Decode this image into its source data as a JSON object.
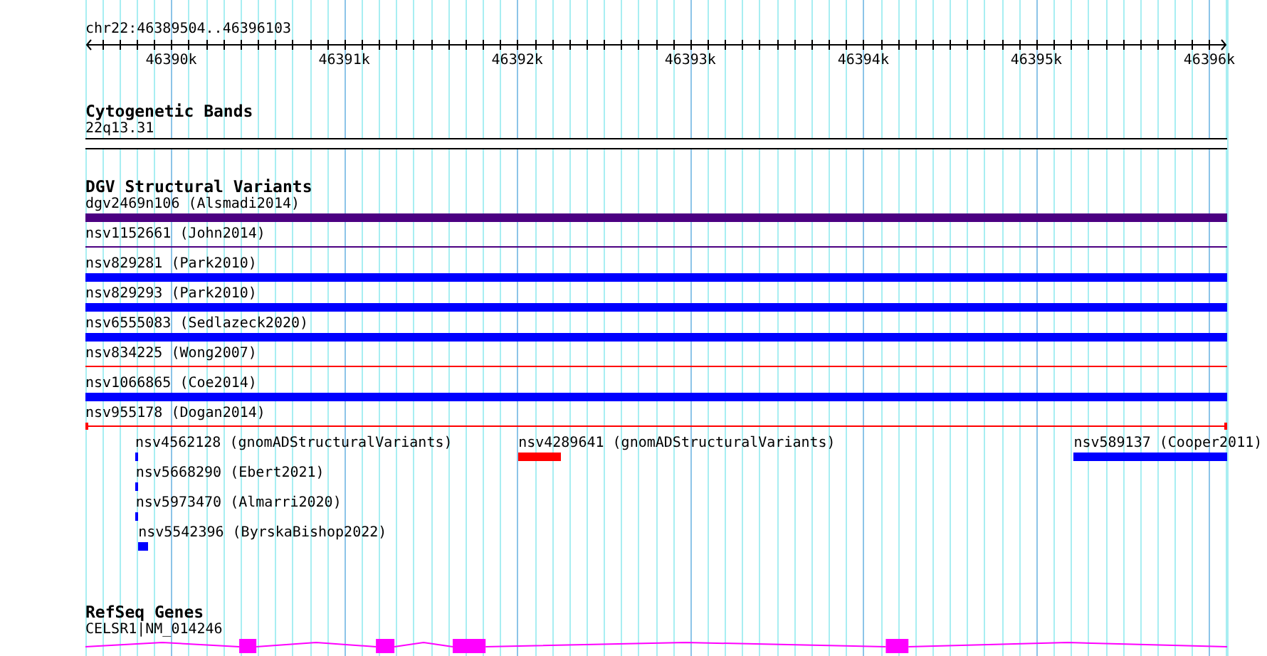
{
  "ruler": {
    "location": "chr22:46389504..46396103",
    "tick_labels": [
      "46390k",
      "46391k",
      "46392k",
      "46393k",
      "46394k",
      "46395k",
      "46396k"
    ]
  },
  "cytoband_track": {
    "title": "Cytogenetic Bands",
    "band": "22q13.31"
  },
  "variant_track": {
    "title": "DGV Structural Variants",
    "lanes": [
      [
        {
          "label": "dgv2469n106 (Alsmadi2014)",
          "kind": "bar",
          "color": "#4b0082"
        }
      ],
      [
        {
          "label": "nsv1152661 (John2014)",
          "kind": "line",
          "color": "#4b0082"
        }
      ],
      [
        {
          "label": "nsv829281 (Park2010)",
          "kind": "bar",
          "color": "#0000ff"
        }
      ],
      [
        {
          "label": "nsv829293 (Park2010)",
          "kind": "bar",
          "color": "#0000ff"
        }
      ],
      [
        {
          "label": "nsv6555083 (Sedlazeck2020)",
          "kind": "bar",
          "color": "#0000ff"
        }
      ],
      [
        {
          "label": "nsv834225 (Wong2007)",
          "kind": "line",
          "color": "#ff0000"
        }
      ],
      [
        {
          "label": "nsv1066865 (Coe2014)",
          "kind": "bar",
          "color": "#0000ff"
        }
      ],
      [
        {
          "label": "nsv955178 (Dogan2014)",
          "kind": "capped",
          "color": "#ff0000"
        }
      ],
      [
        {
          "label": "nsv4562128 (gnomADStructuralVariants)",
          "kind": "bar",
          "color": "#0000ff"
        },
        {
          "label": "nsv4289641 (gnomADStructuralVariants)",
          "kind": "bar",
          "color": "#ff0000"
        },
        {
          "label": "nsv589137 (Cooper2011)",
          "kind": "bar",
          "color": "#0000ff"
        }
      ],
      [
        {
          "label": "nsv5668290 (Ebert2021)",
          "kind": "bar",
          "color": "#0000ff"
        }
      ],
      [
        {
          "label": "nsv5973470 (Almarri2020)",
          "kind": "bar",
          "color": "#0000ff"
        }
      ],
      [
        {
          "label": "nsv5542396 (ByrskaBishop2022)",
          "kind": "bar",
          "color": "#0000ff"
        }
      ]
    ]
  },
  "gene_track": {
    "title": "RefSeq Genes",
    "gene": {
      "label": "CELSR1|NM_014246"
    }
  }
}
